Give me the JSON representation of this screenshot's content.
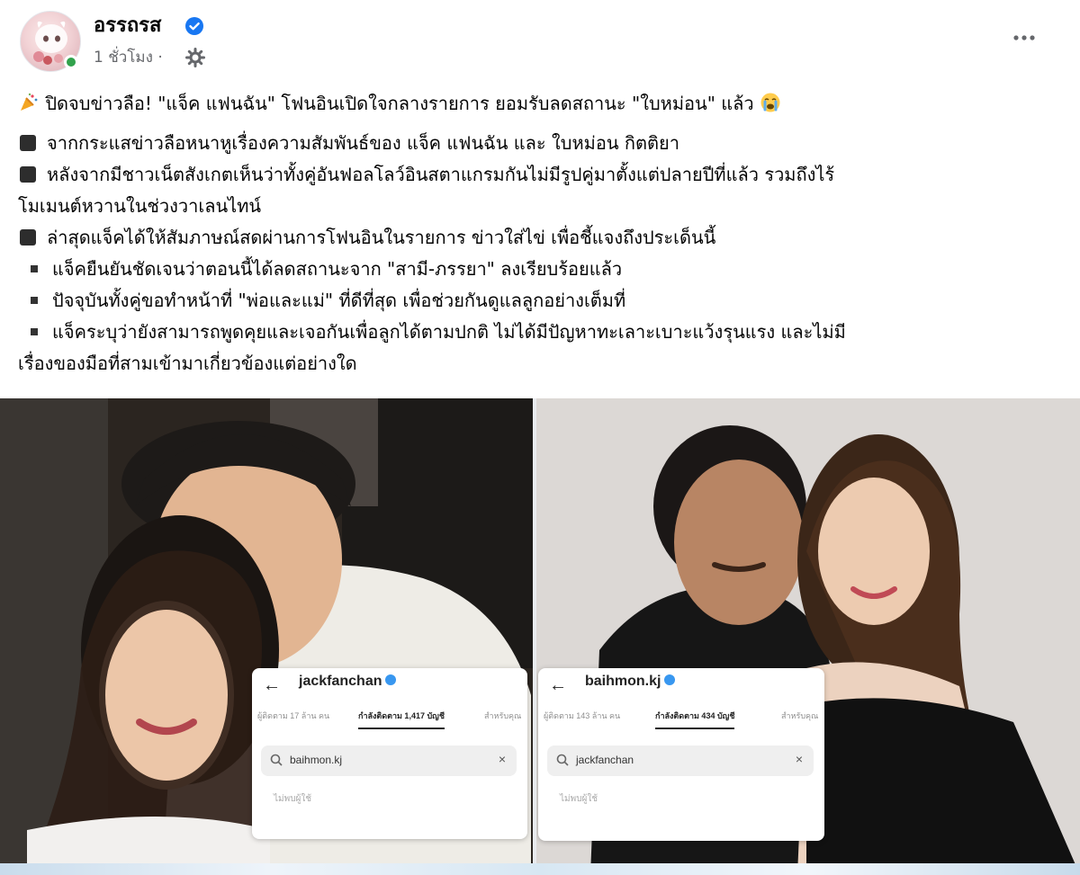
{
  "post": {
    "page_name": "อรรถรส",
    "time": "1 ชั่วโมง",
    "privacy_icon": "gear-icon",
    "more_icon": "more-options-icon",
    "verified_color": "#1877f2",
    "headline": "ปิดจบข่าวลือ! \"แจ็ค แฟนฉัน\" โฟนอินเปิดใจกลางรายการ ยอมรับลดสถานะ \"ใบหม่อน\" แล้ว",
    "lines": [
      "จากกระแสข่าวลือหนาหูเรื่องความสัมพันธ์ของ แจ็ค แฟนฉัน และ ใบหม่อน กิตติยา",
      "หลังจากมีชาวเน็ตสังเกตเห็นว่าทั้งคู่อันฟอลโลว์อินสตาแกรมกันไม่มีรูปคู่มาตั้งแต่ปลายปีที่แล้ว รวมถึงไร้",
      "โมเมนต์หวานในช่วงวาเลนไทน์",
      "ล่าสุดแจ็คได้ให้สัมภาษณ์สดผ่านการโฟนอินในรายการ ข่าวใส่ไข่ เพื่อชี้แจงถึงประเด็นนี้",
      "แจ็คยืนยันชัดเจนว่าตอนนี้ได้ลดสถานะจาก \"สามี-ภรรยา\" ลงเรียบร้อยแล้ว",
      "ปัจจุบันทั้งคู่ขอทำหน้าที่ \"พ่อและแม่\" ที่ดีที่สุด เพื่อช่วยกันดูแลลูกอย่างเต็มที่",
      "แจ็คระบุว่ายังสามารถพูดคุยและเจอกันเพื่อลูกได้ตามปกติ ไม่ได้มีปัญหาทะเลาะเบาะแว้งรุนแรง และไม่มี",
      "เรื่องของมือที่สามเข้ามาเกี่ยวข้องแต่อย่างใด"
    ]
  },
  "ig_left": {
    "username": "jackfanchan",
    "tab_followers": "ผู้ติดตาม 17 ล้าน คน",
    "tab_following": "กำลังติดตาม 1,417 บัญชี",
    "tab_suggested": "สำหรับคุณ",
    "search_query": "baihmon.kj",
    "empty_text": "ไม่พบผู้ใช้"
  },
  "ig_right": {
    "username": "baihmon.kj",
    "tab_followers": "ผู้ติดตาม 143 ล้าน คน",
    "tab_following": "กำลังติดตาม 434 บัญชี",
    "tab_suggested": "สำหรับคุณ",
    "search_query": "jackfanchan",
    "empty_text": "ไม่พบผู้ใช้"
  }
}
